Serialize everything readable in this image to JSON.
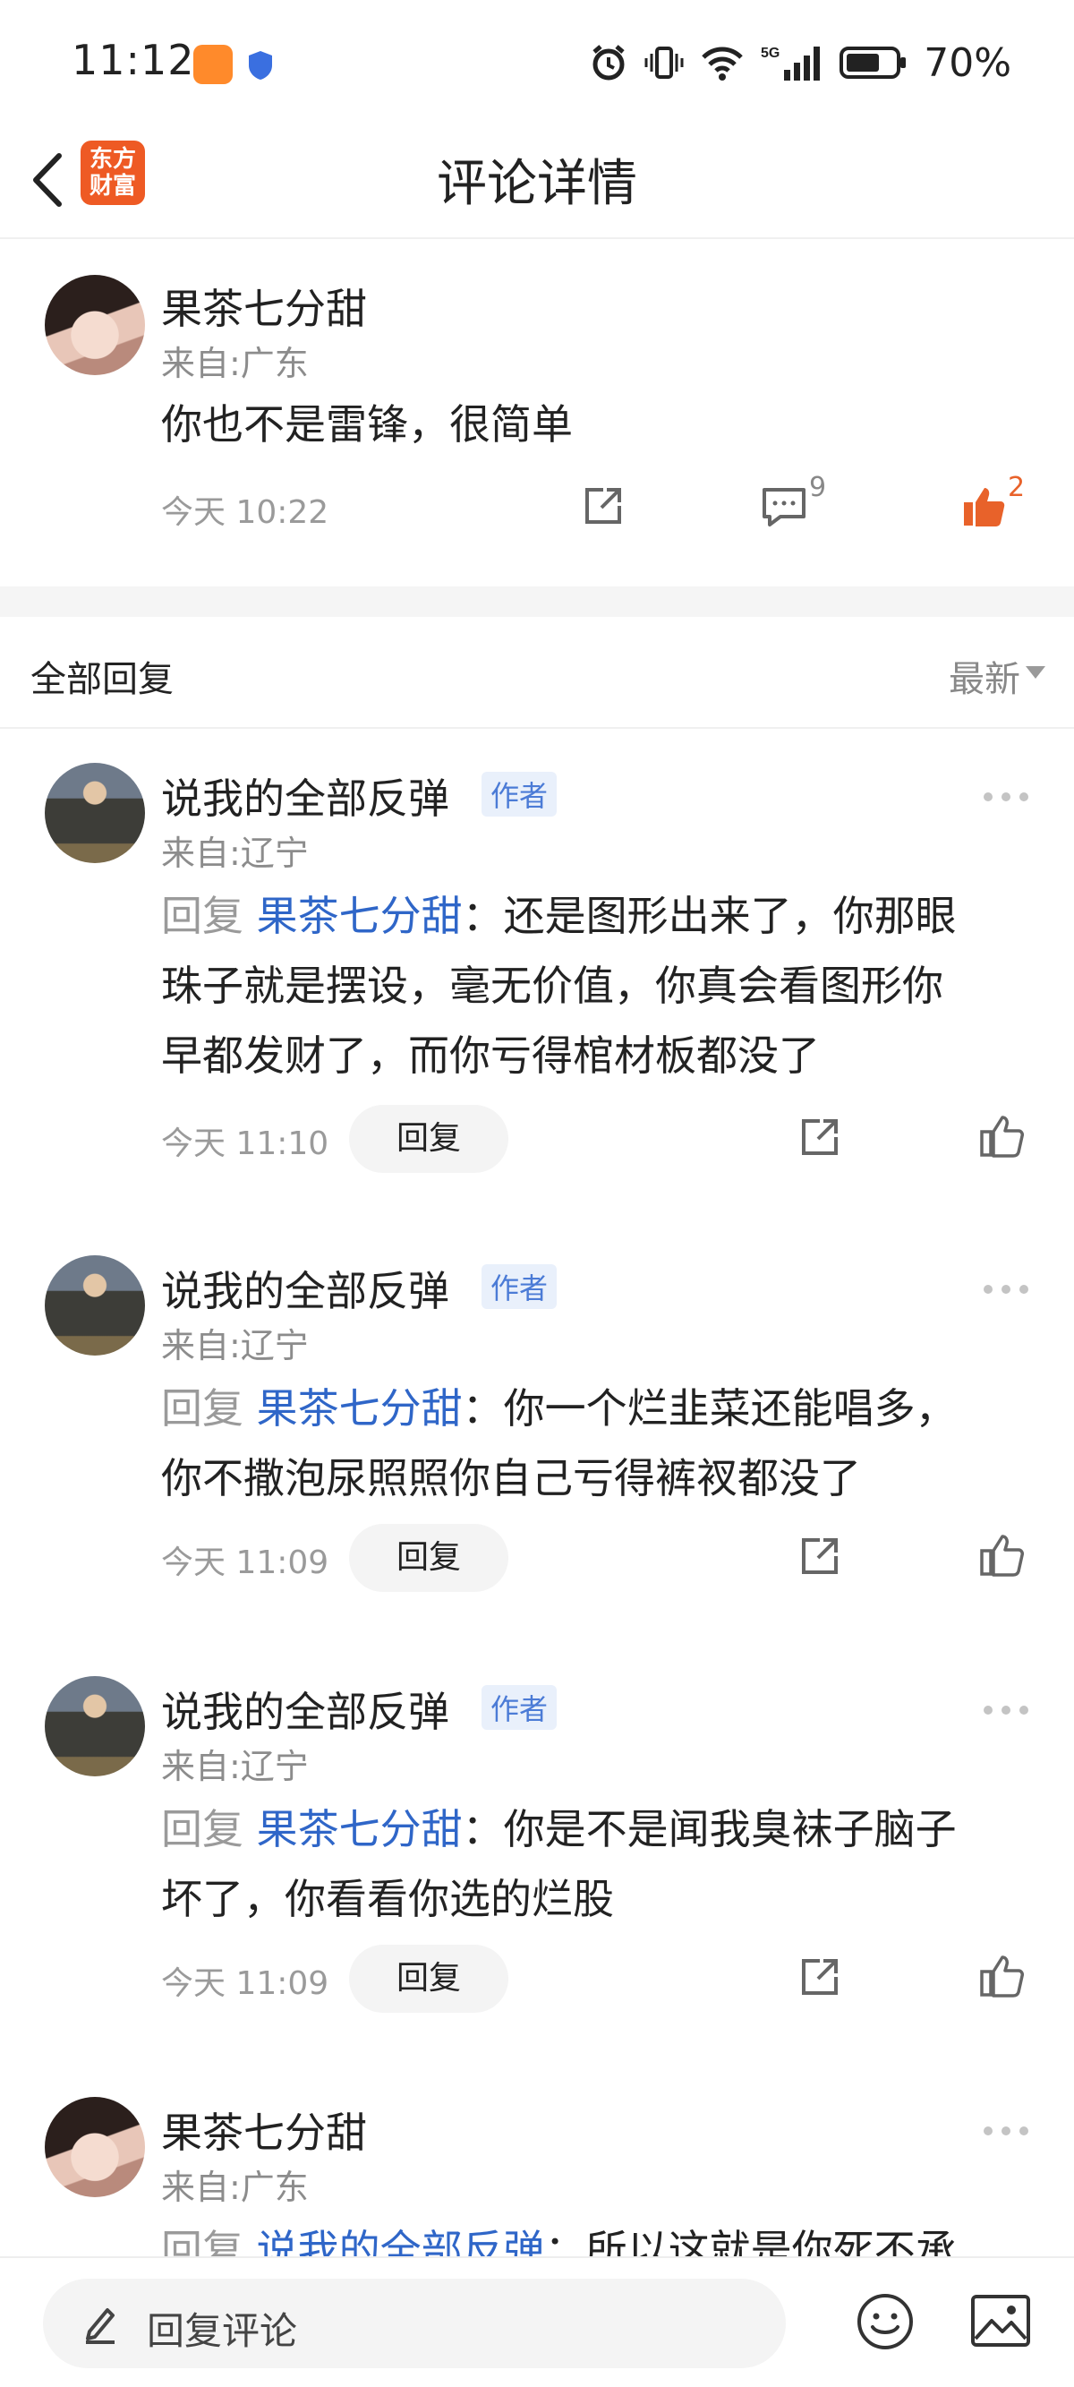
{
  "status_bar": {
    "time": "11:12",
    "battery": "70%",
    "network": "5G"
  },
  "nav": {
    "title": "评论详情",
    "logo_line1": "东方",
    "logo_line2": "财富"
  },
  "main_comment": {
    "user": "果茶七分甜",
    "location": "来自:广东",
    "content": "你也不是雷锋，很简单",
    "time": "今天 10:22",
    "comment_count": "9",
    "like_count": "2"
  },
  "replies_header": {
    "title": "全部回复",
    "sort_label": "最新"
  },
  "replies": [
    {
      "user": "说我的全部反弹",
      "tag": "作者",
      "location": "来自:辽宁",
      "prefix": "回复",
      "target": "果茶七分甜",
      "line1": "：还是图形出来了，你那眼",
      "line2": "珠子就是摆设，毫无价值，你真会看图形你",
      "line3": "早都发财了，而你亏得棺材板都没了",
      "time": "今天 11:10",
      "reply_label": "回复"
    },
    {
      "user": "说我的全部反弹",
      "tag": "作者",
      "location": "来自:辽宁",
      "prefix": "回复",
      "target": "果茶七分甜",
      "line1": "：你一个烂韭菜还能唱多，",
      "line2": "你不撒泡尿照照你自己亏得裤衩都没了",
      "time": "今天 11:09",
      "reply_label": "回复"
    },
    {
      "user": "说我的全部反弹",
      "tag": "作者",
      "location": "来自:辽宁",
      "prefix": "回复",
      "target": "果茶七分甜",
      "line1": "：你是不是闻我臭袜子脑子",
      "line2": "坏了，你看看你选的烂股",
      "time": "今天 11:09",
      "reply_label": "回复"
    },
    {
      "user": "果茶七分甜",
      "location": "来自:广东",
      "prefix": "回复",
      "target": "说我的全部反弹",
      "line1": "：所以这就是你死不承"
    }
  ],
  "bottom_bar": {
    "placeholder": "回复评论"
  },
  "colors": {
    "accent_blue": "#2f66c8",
    "like_orange": "#e8622a",
    "brand_red": "#ee5a24"
  }
}
